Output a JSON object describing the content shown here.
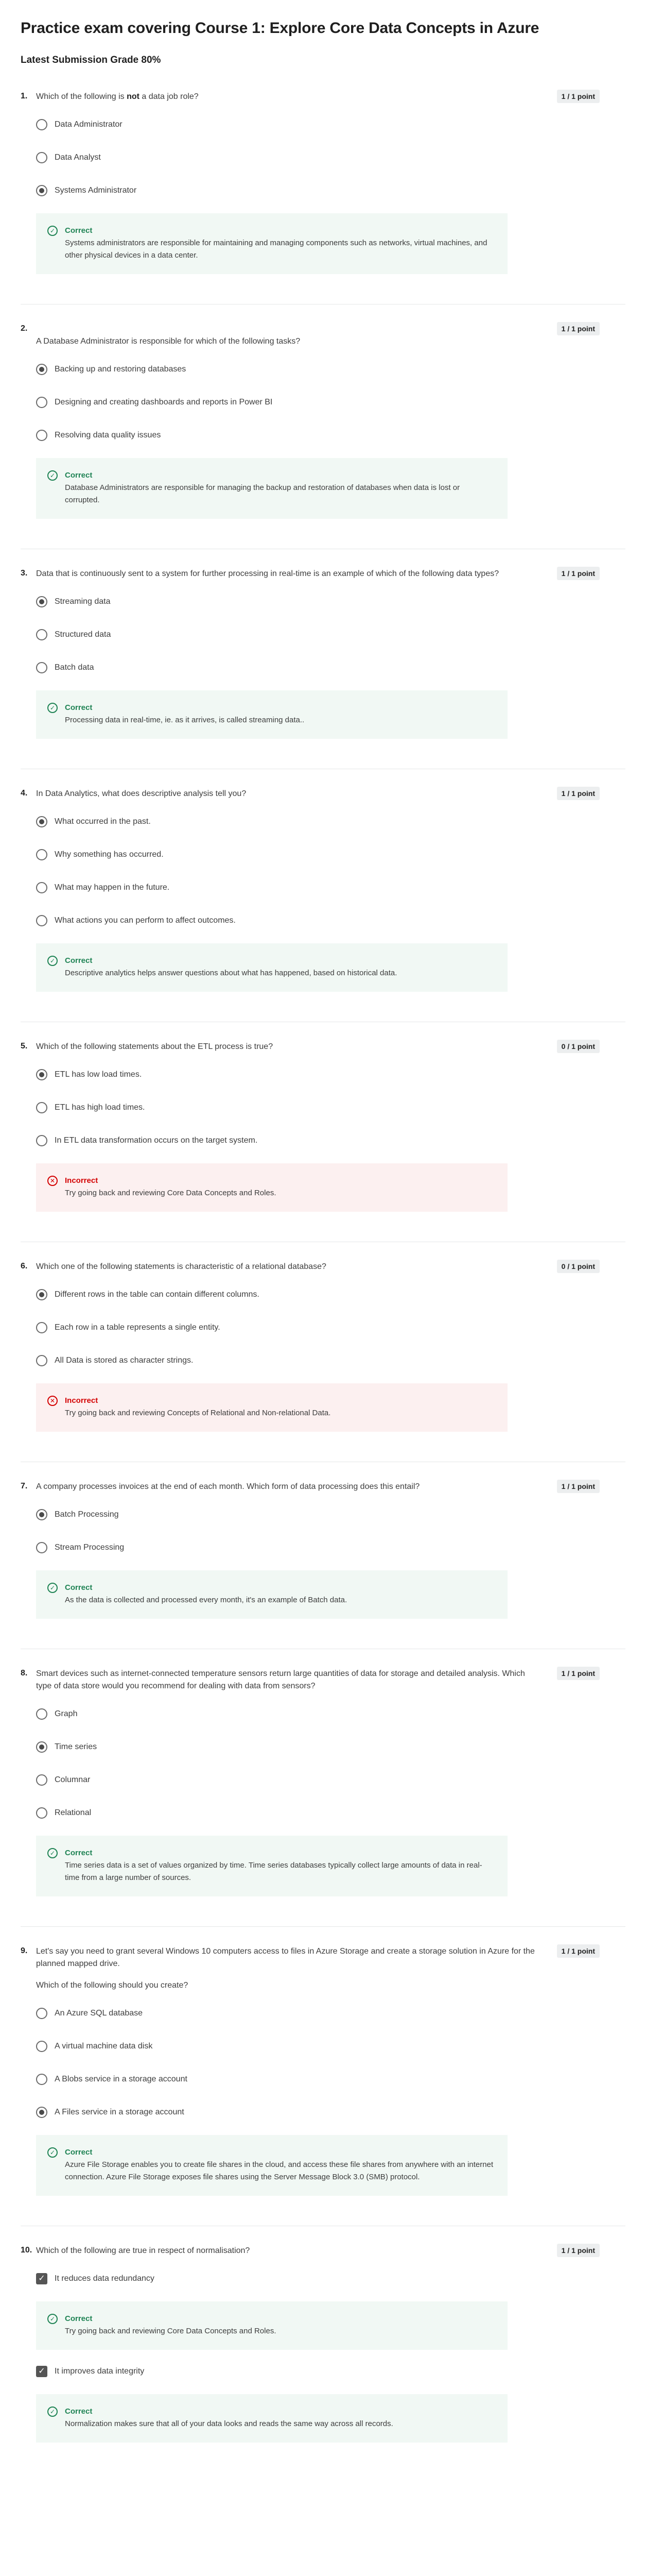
{
  "page": {
    "title": "Practice exam covering Course 1: Explore Core Data Concepts in Azure",
    "grade": "Latest Submission Grade 80%"
  },
  "questions": [
    {
      "num": "1.",
      "text_before": "Which of the following is ",
      "text_bold": "not",
      "text_after": " a data job role?",
      "points": "1 / 1 point",
      "options": [
        "Data Administrator",
        "Data Analyst",
        "Systems Administrator"
      ],
      "selected": 2,
      "feedback": {
        "title": "Correct",
        "text": "Systems administrators are responsible for maintaining and managing components such as networks, virtual machines, and other physical devices in a data center."
      }
    },
    {
      "num": "2.",
      "text": "A Database Administrator is responsible for which of the following tasks?",
      "points": "1 / 1 point",
      "options": [
        "Backing up and restoring databases",
        "Designing and creating dashboards and reports in Power BI",
        "Resolving data quality issues"
      ],
      "selected": 0,
      "feedback": {
        "title": "Correct",
        "text": "Database Administrators are responsible for managing the backup and restoration of databases when data is lost or corrupted."
      }
    },
    {
      "num": "3.",
      "text": "Data that is continuously sent to a system for further processing in real-time is an example of which of the following data types?",
      "points": "1 / 1 point",
      "options": [
        "Streaming data",
        "Structured data",
        "Batch data"
      ],
      "selected": 0,
      "feedback": {
        "title": "Correct",
        "text": "Processing data in real-time, ie. as it arrives, is called streaming data.."
      }
    },
    {
      "num": "4.",
      "text": "In Data Analytics, what does descriptive analysis tell you?",
      "points": "1 / 1 point",
      "options": [
        "What occurred in the past.",
        "Why something has occurred.",
        "What may happen in the future.",
        "What actions you can perform to affect outcomes."
      ],
      "selected": 0,
      "feedback": {
        "title": "Correct",
        "text": "Descriptive analytics helps answer questions about what has happened, based on historical data."
      }
    },
    {
      "num": "5.",
      "text": "Which of the following statements about the ETL process is true?",
      "points": "0 / 1 point",
      "options": [
        "ETL has low load times.",
        "ETL has high load times.",
        "In ETL data transformation occurs on the target system."
      ],
      "selected": 0,
      "feedback": {
        "title": "Incorrect",
        "text": "Try going back and reviewing Core Data Concepts and Roles."
      }
    },
    {
      "num": "6.",
      "text": "Which one of the following statements is characteristic of a relational database?",
      "points": "0 / 1 point",
      "options": [
        "Different rows in the table can contain different columns.",
        "Each row in a table represents a single entity.",
        "All Data is stored as character strings."
      ],
      "selected": 0,
      "feedback": {
        "title": "Incorrect",
        "text": "Try going back and reviewing Concepts of Relational and Non-relational Data."
      }
    },
    {
      "num": "7.",
      "text": "A company processes invoices at the end of each month. Which form of data processing does this entail?",
      "points": "1 / 1 point",
      "options": [
        "Batch Processing",
        "Stream Processing"
      ],
      "selected": 0,
      "feedback": {
        "title": "Correct",
        "text": "As the data is collected and processed every month, it's an example of Batch data."
      }
    },
    {
      "num": "8.",
      "text": "Smart devices such as internet-connected temperature sensors return large quantities of data for storage and detailed analysis. Which type of data store would you recommend for dealing with data from sensors?",
      "points": "1 / 1 point",
      "options": [
        "Graph",
        "Time series",
        "Columnar",
        "Relational"
      ],
      "selected": 1,
      "feedback": {
        "title": "Correct",
        "text": "Time series data is a set of values organized by time. Time series databases typically collect large amounts of data in real-time from a large number of sources."
      }
    },
    {
      "num": "9.",
      "text": "Let's say you need to grant several Windows 10 computers access to files in Azure Storage and create a storage solution in Azure for the planned mapped drive.",
      "sub": "Which of the following should you create?",
      "points": "1 / 1 point",
      "options": [
        "An Azure SQL database",
        "A virtual machine data disk",
        "A Blobs service in a storage account",
        "A Files service in a storage account"
      ],
      "selected": 3,
      "feedback": {
        "title": "Correct",
        "text": "Azure File Storage enables you to create file shares in the cloud, and access these file shares from anywhere with an internet connection. Azure File Storage exposes file shares using the Server Message Block 3.0 (SMB) protocol."
      }
    },
    {
      "num": "10.",
      "text": "Which of the following are true in respect of normalisation?",
      "points": "1 / 1 point",
      "check1": "It reduces data redundancy",
      "fb1": {
        "title": "Correct",
        "text": "Try going back and reviewing Core Data Concepts and Roles."
      },
      "check2": "It improves data integrity",
      "fb2": {
        "title": "Correct",
        "text": "Normalization makes sure that all of your data looks and reads the same way across all records."
      }
    }
  ],
  "icons": {
    "correct": "check-circle-icon",
    "incorrect": "x-circle-icon",
    "checked": "checkbox-checked-icon"
  },
  "colors": {
    "correct": "#1f8354",
    "incorrect": "#d30001",
    "correct_bg": "#f1f8f4",
    "incorrect_bg": "#fcf0f0"
  }
}
